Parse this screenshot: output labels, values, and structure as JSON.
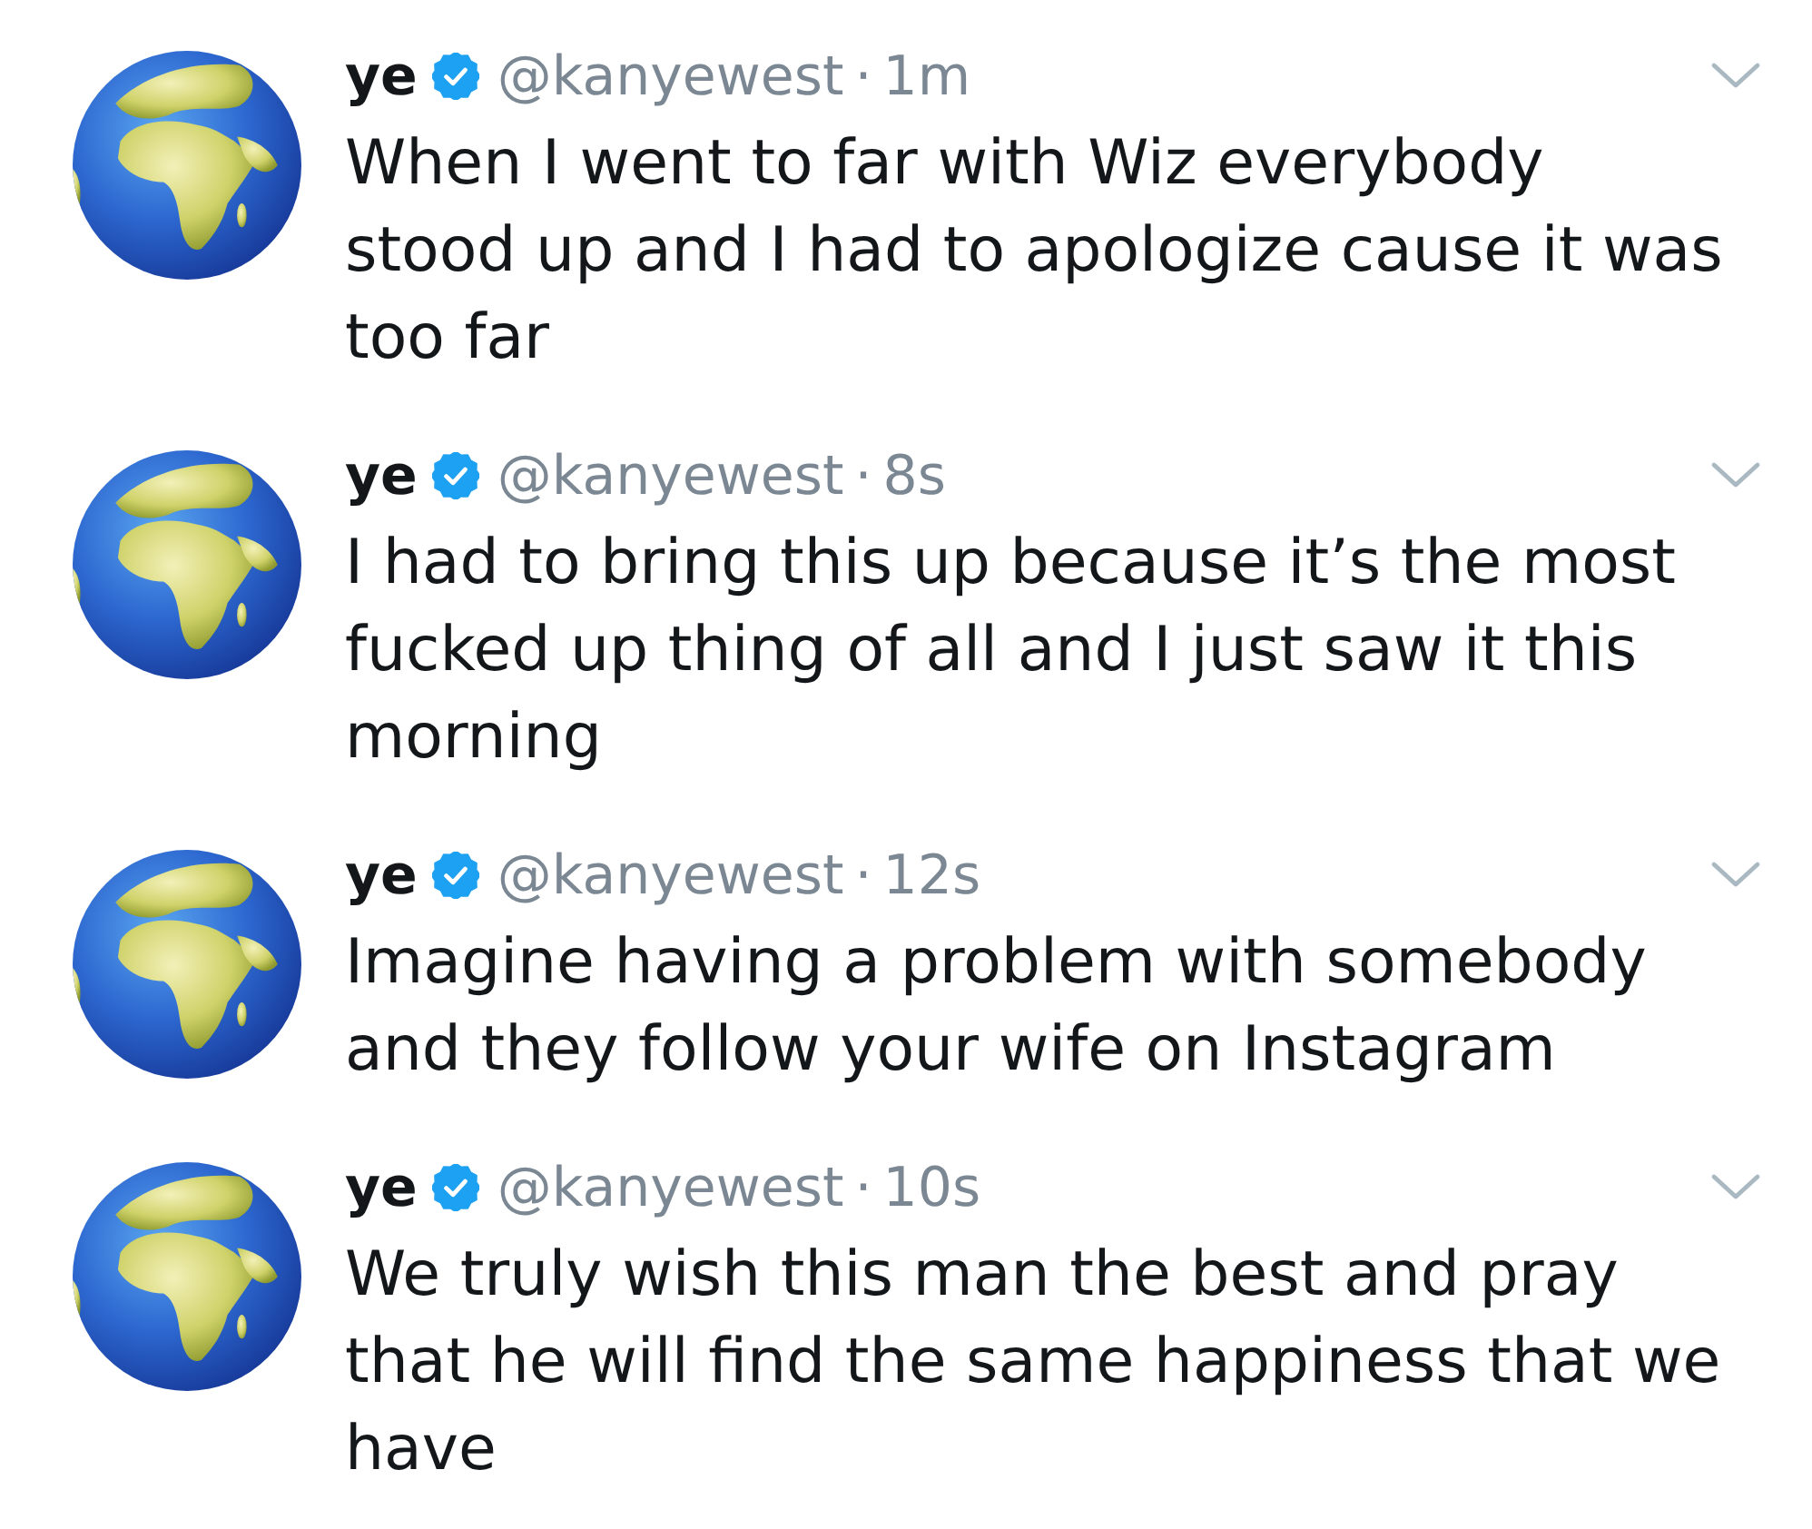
{
  "tweets": [
    {
      "name": "ye",
      "verified": true,
      "handle": "@kanyewest",
      "separator": "·",
      "time": "1m",
      "text": "When I went to far with Wiz everybody\nstood up and I had to apologize cause it was\ntoo far"
    },
    {
      "name": "ye",
      "verified": true,
      "handle": "@kanyewest",
      "separator": "·",
      "time": "8s",
      "text": "I had to bring this up because it’s the most\nfucked up thing of all and I just saw it this\nmorning"
    },
    {
      "name": "ye",
      "verified": true,
      "handle": "@kanyewest",
      "separator": "·",
      "time": "12s",
      "text": "Imagine having a problem with somebody\nand they follow your wife on Instagram"
    },
    {
      "name": "ye",
      "verified": true,
      "handle": "@kanyewest",
      "separator": "·",
      "time": "10s",
      "text": "We truly wish this man the best and pray\nthat he will find the same happiness that we\nhave"
    }
  ]
}
